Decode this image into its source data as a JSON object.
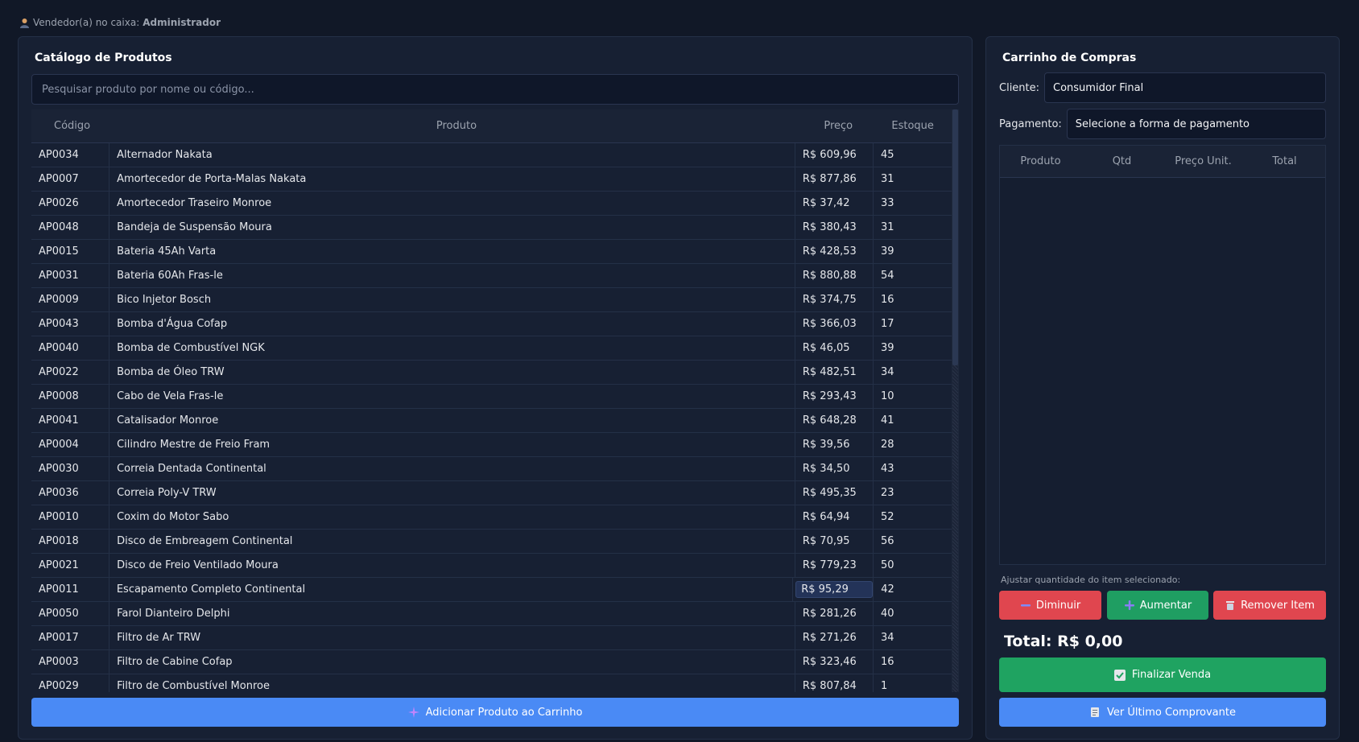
{
  "header": {
    "seller_prefix": "Vendedor(a) no caixa:",
    "seller_name": "Administrador"
  },
  "catalog": {
    "title": "Catálogo de Produtos",
    "search_placeholder": "Pesquisar produto por nome ou código...",
    "columns": [
      "Código",
      "Produto",
      "Preço",
      "Estoque"
    ],
    "rows": [
      [
        "AP0034",
        "Alternador Nakata",
        "R$ 609,96",
        "45"
      ],
      [
        "AP0007",
        "Amortecedor de Porta-Malas Nakata",
        "R$ 877,86",
        "31"
      ],
      [
        "AP0026",
        "Amortecedor Traseiro Monroe",
        "R$ 37,42",
        "33"
      ],
      [
        "AP0048",
        "Bandeja de Suspensão Moura",
        "R$ 380,43",
        "31"
      ],
      [
        "AP0015",
        "Bateria 45Ah Varta",
        "R$ 428,53",
        "39"
      ],
      [
        "AP0031",
        "Bateria 60Ah Fras-le",
        "R$ 880,88",
        "54"
      ],
      [
        "AP0009",
        "Bico Injetor Bosch",
        "R$ 374,75",
        "16"
      ],
      [
        "AP0043",
        "Bomba d'Água Cofap",
        "R$ 366,03",
        "17"
      ],
      [
        "AP0040",
        "Bomba de Combustível NGK",
        "R$ 46,05",
        "39"
      ],
      [
        "AP0022",
        "Bomba de Óleo TRW",
        "R$ 482,51",
        "34"
      ],
      [
        "AP0008",
        "Cabo de Vela Fras-le",
        "R$ 293,43",
        "10"
      ],
      [
        "AP0041",
        "Catalisador Monroe",
        "R$ 648,28",
        "41"
      ],
      [
        "AP0004",
        "Cilindro Mestre de Freio Fram",
        "R$ 39,56",
        "28"
      ],
      [
        "AP0030",
        "Correia Dentada Continental",
        "R$ 34,50",
        "43"
      ],
      [
        "AP0036",
        "Correia Poly-V TRW",
        "R$ 495,35",
        "23"
      ],
      [
        "AP0010",
        "Coxim do Motor Sabo",
        "R$ 64,94",
        "52"
      ],
      [
        "AP0018",
        "Disco de Embreagem Continental",
        "R$ 70,95",
        "56"
      ],
      [
        "AP0021",
        "Disco de Freio Ventilado Moura",
        "R$ 779,23",
        "50"
      ],
      [
        "AP0011",
        "Escapamento Completo Continental",
        "R$ 95,29",
        "42"
      ],
      [
        "AP0050",
        "Farol Dianteiro Delphi",
        "R$ 281,26",
        "40"
      ],
      [
        "AP0017",
        "Filtro de Ar TRW",
        "R$ 271,26",
        "34"
      ],
      [
        "AP0003",
        "Filtro de Cabine Cofap",
        "R$ 323,46",
        "16"
      ],
      [
        "AP0029",
        "Filtro de Combustível Monroe",
        "R$ 807,84",
        "1"
      ]
    ],
    "selected_row": 18,
    "add_button": "Adicionar Produto ao Carrinho",
    "add_icon": "sparkle-icon"
  },
  "cart": {
    "title": "Carrinho de Compras",
    "client_label": "Cliente:",
    "client_value": "Consumidor Final",
    "payment_label": "Pagamento:",
    "payment_value": "Selecione a forma de pagamento",
    "columns": [
      "Produto",
      "Qtd",
      "Preço Unit.",
      "Total"
    ],
    "adjust_label": "Ajustar quantidade do item selecionado:",
    "decrease_button": "Diminuir",
    "increase_button": "Aumentar",
    "remove_button": "Remover Item",
    "total_text": "Total: R$ 0,00",
    "finish_button": "Finalizar Venda",
    "receipt_button": "Ver Último Comprovante"
  },
  "colors": {
    "background": "#111827",
    "panel": "#172033",
    "accent_blue": "#4a8af5",
    "accent_green": "#1fa361",
    "accent_red": "#e0464f"
  }
}
